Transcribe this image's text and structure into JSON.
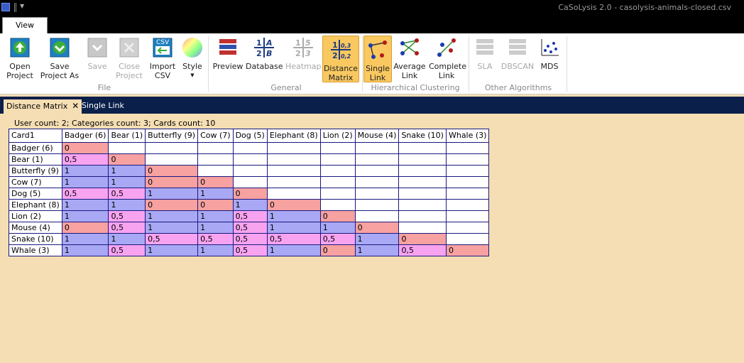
{
  "window": {
    "title": "CaSoLysis 2.0 - casolysis-animals-closed.csv"
  },
  "ribbon": {
    "tab": "View",
    "groups": [
      {
        "label": "File"
      },
      {
        "label": "General"
      },
      {
        "label": "Hierarchical Clustering"
      },
      {
        "label": "Other Algorithms"
      }
    ],
    "buttons": {
      "open_project": "Open\nProject",
      "save_project_as": "Save\nProject As",
      "save": "Save",
      "close_project": "Close\nProject",
      "import_csv": "Import\nCSV",
      "style": "Style",
      "preview": "Preview",
      "database": "Database",
      "heatmap": "Heatmap",
      "distance_matrix": "Distance\nMatrix",
      "single_link": "Single\nLink",
      "average_link": "Average\nLink",
      "complete_link": "Complete\nLink",
      "sla": "SLA",
      "dbscan": "DBSCAN",
      "mds": "MDS"
    },
    "csv_badge": "CSV"
  },
  "doc_tabs": [
    {
      "label": "Distance Matrix",
      "active": true
    },
    {
      "label": "Single Link",
      "active": false
    }
  ],
  "info_text": "User count: 2; Categories count: 3; Cards count: 10",
  "matrix": {
    "corner": "Card1",
    "columns": [
      "Badger (6)",
      "Bear (1)",
      "Butterfly (9)",
      "Cow (7)",
      "Dog (5)",
      "Elephant (8)",
      "Lion (2)",
      "Mouse (4)",
      "Snake (10)",
      "Whale (3)"
    ],
    "rows": [
      {
        "label": "Badger (6)",
        "values": [
          "0"
        ]
      },
      {
        "label": "Bear (1)",
        "values": [
          "0,5",
          "0"
        ]
      },
      {
        "label": "Butterfly (9)",
        "values": [
          "1",
          "1",
          "0"
        ]
      },
      {
        "label": "Cow (7)",
        "values": [
          "1",
          "1",
          "0",
          "0"
        ]
      },
      {
        "label": "Dog (5)",
        "values": [
          "0,5",
          "0,5",
          "1",
          "1",
          "0"
        ]
      },
      {
        "label": "Elephant (8)",
        "values": [
          "1",
          "1",
          "0",
          "0",
          "1",
          "0"
        ]
      },
      {
        "label": "Lion (2)",
        "values": [
          "1",
          "0,5",
          "1",
          "1",
          "0,5",
          "1",
          "0"
        ]
      },
      {
        "label": "Mouse (4)",
        "values": [
          "0",
          "0,5",
          "1",
          "1",
          "0,5",
          "1",
          "1",
          "0"
        ]
      },
      {
        "label": "Snake (10)",
        "values": [
          "1",
          "1",
          "0,5",
          "0,5",
          "0,5",
          "0,5",
          "0,5",
          "1",
          "0"
        ]
      },
      {
        "label": "Whale (3)",
        "values": [
          "1",
          "0,5",
          "1",
          "1",
          "0,5",
          "1",
          "0",
          "1",
          "0,5",
          "0"
        ]
      }
    ]
  },
  "colors": {
    "zero": "#f7a1a1",
    "half": "#f7a3f0",
    "one": "#a8a8f5",
    "background": "#f5deb3",
    "active_button": "#f9c860"
  }
}
